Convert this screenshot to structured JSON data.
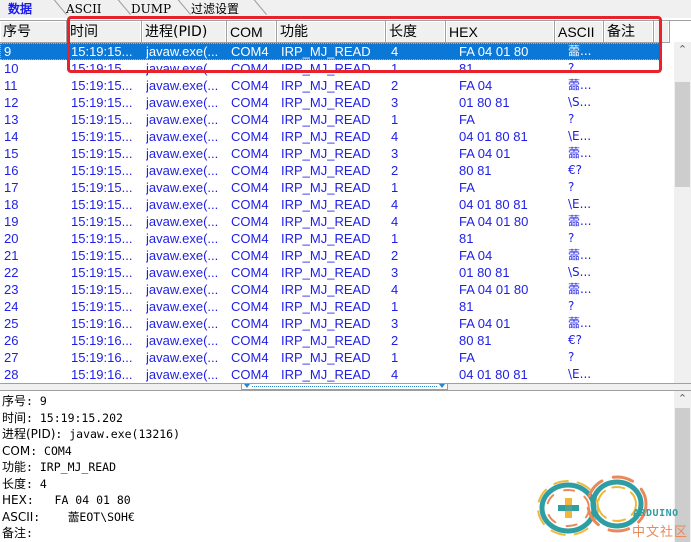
{
  "tabs": [
    {
      "label": "数据",
      "active": true
    },
    {
      "label": "ASCII",
      "active": false
    },
    {
      "label": "DUMP",
      "active": false
    },
    {
      "label": "过滤设置",
      "active": false
    }
  ],
  "table": {
    "columns": [
      "序号",
      "时间",
      "进程(PID)",
      "COM",
      "功能",
      "长度",
      "HEX",
      "ASCII",
      "备注"
    ],
    "selected_index": 0,
    "rows": [
      {
        "seq": "9",
        "time": "15:19:15...",
        "proc": "javaw.exe(...",
        "com": "COM4",
        "func": "IRP_MJ_READ",
        "len": "4",
        "hex": "FA 04 01 80",
        "ascii": "蘦...",
        "note": ""
      },
      {
        "seq": "10",
        "time": "15:19:15...",
        "proc": "javaw.exe(...",
        "com": "COM4",
        "func": "IRP_MJ_READ",
        "len": "1",
        "hex": "81",
        "ascii": "?",
        "note": ""
      },
      {
        "seq": "11",
        "time": "15:19:15...",
        "proc": "javaw.exe(...",
        "com": "COM4",
        "func": "IRP_MJ_READ",
        "len": "2",
        "hex": "FA 04",
        "ascii": "蘦...",
        "note": ""
      },
      {
        "seq": "12",
        "time": "15:19:15...",
        "proc": "javaw.exe(...",
        "com": "COM4",
        "func": "IRP_MJ_READ",
        "len": "3",
        "hex": "01 80 81",
        "ascii": "\\S...",
        "note": ""
      },
      {
        "seq": "13",
        "time": "15:19:15...",
        "proc": "javaw.exe(...",
        "com": "COM4",
        "func": "IRP_MJ_READ",
        "len": "1",
        "hex": "FA",
        "ascii": "?",
        "note": ""
      },
      {
        "seq": "14",
        "time": "15:19:15...",
        "proc": "javaw.exe(...",
        "com": "COM4",
        "func": "IRP_MJ_READ",
        "len": "4",
        "hex": "04 01 80 81",
        "ascii": "\\E...",
        "note": ""
      },
      {
        "seq": "15",
        "time": "15:19:15...",
        "proc": "javaw.exe(...",
        "com": "COM4",
        "func": "IRP_MJ_READ",
        "len": "3",
        "hex": "FA 04 01",
        "ascii": "蘦...",
        "note": ""
      },
      {
        "seq": "16",
        "time": "15:19:15...",
        "proc": "javaw.exe(...",
        "com": "COM4",
        "func": "IRP_MJ_READ",
        "len": "2",
        "hex": "80 81",
        "ascii": "€?",
        "note": ""
      },
      {
        "seq": "17",
        "time": "15:19:15...",
        "proc": "javaw.exe(...",
        "com": "COM4",
        "func": "IRP_MJ_READ",
        "len": "1",
        "hex": "FA",
        "ascii": "?",
        "note": ""
      },
      {
        "seq": "18",
        "time": "15:19:15...",
        "proc": "javaw.exe(...",
        "com": "COM4",
        "func": "IRP_MJ_READ",
        "len": "4",
        "hex": "04 01 80 81",
        "ascii": "\\E...",
        "note": ""
      },
      {
        "seq": "19",
        "time": "15:19:15...",
        "proc": "javaw.exe(...",
        "com": "COM4",
        "func": "IRP_MJ_READ",
        "len": "4",
        "hex": "FA 04 01 80",
        "ascii": "蘦...",
        "note": ""
      },
      {
        "seq": "20",
        "time": "15:19:15...",
        "proc": "javaw.exe(...",
        "com": "COM4",
        "func": "IRP_MJ_READ",
        "len": "1",
        "hex": "81",
        "ascii": "?",
        "note": ""
      },
      {
        "seq": "21",
        "time": "15:19:15...",
        "proc": "javaw.exe(...",
        "com": "COM4",
        "func": "IRP_MJ_READ",
        "len": "2",
        "hex": "FA 04",
        "ascii": "蘦...",
        "note": ""
      },
      {
        "seq": "22",
        "time": "15:19:15...",
        "proc": "javaw.exe(...",
        "com": "COM4",
        "func": "IRP_MJ_READ",
        "len": "3",
        "hex": "01 80 81",
        "ascii": "\\S...",
        "note": ""
      },
      {
        "seq": "23",
        "time": "15:19:15...",
        "proc": "javaw.exe(...",
        "com": "COM4",
        "func": "IRP_MJ_READ",
        "len": "4",
        "hex": "FA 04 01 80",
        "ascii": "蘦...",
        "note": ""
      },
      {
        "seq": "24",
        "time": "15:19:15...",
        "proc": "javaw.exe(...",
        "com": "COM4",
        "func": "IRP_MJ_READ",
        "len": "1",
        "hex": "81",
        "ascii": "?",
        "note": ""
      },
      {
        "seq": "25",
        "time": "15:19:16...",
        "proc": "javaw.exe(...",
        "com": "COM4",
        "func": "IRP_MJ_READ",
        "len": "3",
        "hex": "FA 04 01",
        "ascii": "蘦...",
        "note": ""
      },
      {
        "seq": "26",
        "time": "15:19:16...",
        "proc": "javaw.exe(...",
        "com": "COM4",
        "func": "IRP_MJ_READ",
        "len": "2",
        "hex": "80 81",
        "ascii": "€?",
        "note": ""
      },
      {
        "seq": "27",
        "time": "15:19:16...",
        "proc": "javaw.exe(...",
        "com": "COM4",
        "func": "IRP_MJ_READ",
        "len": "1",
        "hex": "FA",
        "ascii": "?",
        "note": ""
      },
      {
        "seq": "28",
        "time": "15:19:16...",
        "proc": "javaw.exe(...",
        "com": "COM4",
        "func": "IRP_MJ_READ",
        "len": "4",
        "hex": "04 01 80 81",
        "ascii": "\\E...",
        "note": ""
      }
    ]
  },
  "scroll": {
    "up_icon": "⌃",
    "down_icon": "⌄"
  },
  "detail": {
    "lines": [
      {
        "label": "序号",
        "sep": ": ",
        "value": "9"
      },
      {
        "label": "时间",
        "sep": ": ",
        "value": "15:19:15.202"
      },
      {
        "label": "进程(PID)",
        "sep": ": ",
        "value": "javaw.exe(13216)"
      },
      {
        "label": "COM",
        "sep": ": ",
        "value": "COM4"
      },
      {
        "label": "功能",
        "sep": ": ",
        "value": "IRP_MJ_READ"
      },
      {
        "label": "长度",
        "sep": ": ",
        "value": "4"
      },
      {
        "label": "HEX",
        "sep": ":   ",
        "value": "FA 04 01 80"
      },
      {
        "label": "ASCII",
        "sep": ":    ",
        "value": "蘦EOT\\SOH€"
      },
      {
        "label": "备注",
        "sep": ":",
        "value": ""
      }
    ]
  },
  "watermark": {
    "line1": "ARDUINO",
    "line2": "中文社区"
  },
  "colors": {
    "row_text": "#1e1ee6",
    "selection": "#0b78d7",
    "highlight_box": "#e8212a"
  }
}
